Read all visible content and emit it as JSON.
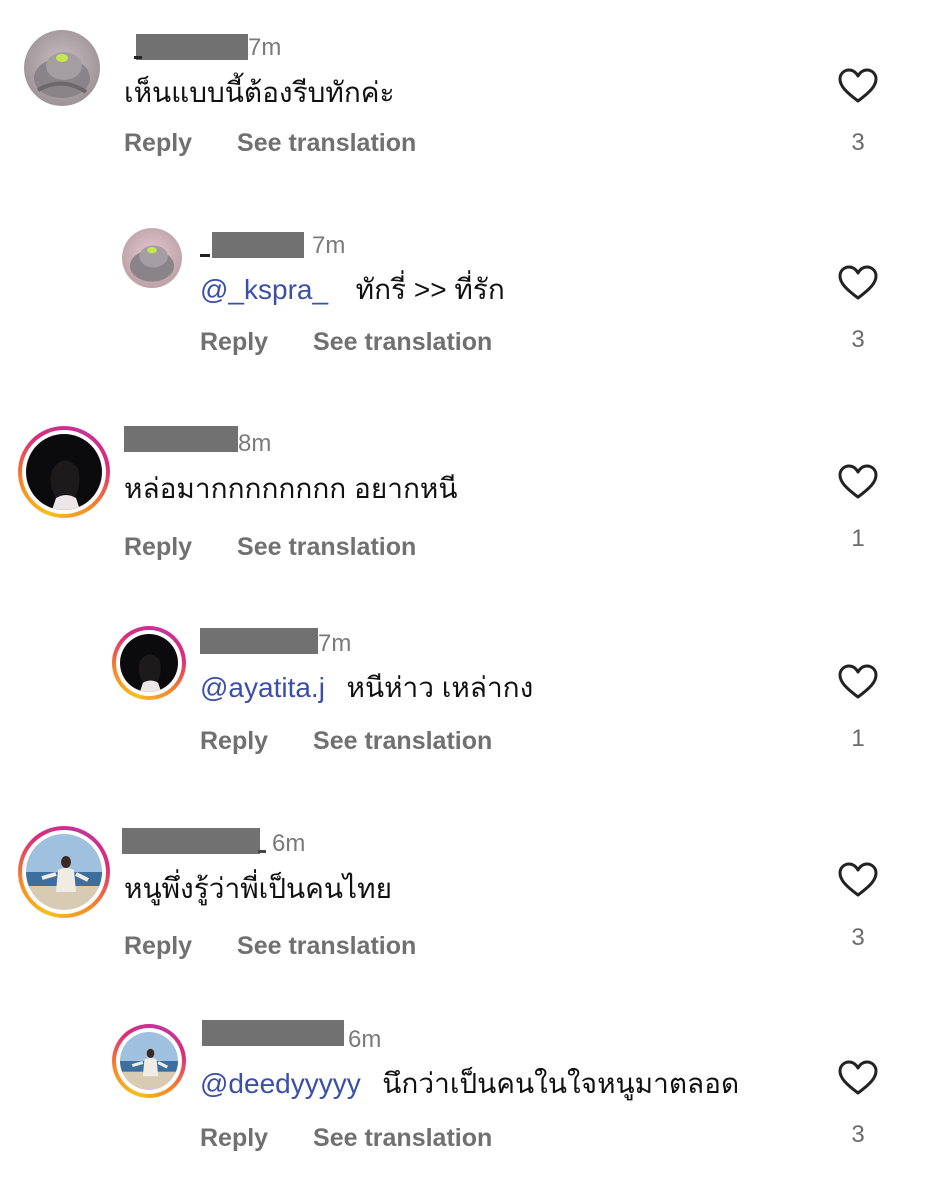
{
  "comments": [
    {
      "timestamp": "7m",
      "text": "เห็นแบบนี้ต้องรีบทักค่ะ",
      "mention": "",
      "reply_label": "Reply",
      "translate_label": "See translation",
      "likes": "3",
      "is_reply": false,
      "avatar": "cat-avatar"
    },
    {
      "timestamp": "7m",
      "text": "ทักรี่ >> ที่รัก",
      "mention": "@_kspra_",
      "reply_label": "Reply",
      "translate_label": "See translation",
      "likes": "3",
      "is_reply": true,
      "avatar": "cat-avatar"
    },
    {
      "timestamp": "8m",
      "text": "หล่อมากกกกกกกก อยากหนี",
      "mention": "",
      "reply_label": "Reply",
      "translate_label": "See translation",
      "likes": "1",
      "is_reply": false,
      "avatar": "night-portrait-avatar-story-ring"
    },
    {
      "timestamp": "7m",
      "text": "หนีห่าว เหล่ากง",
      "mention": "@ayatita.j",
      "reply_label": "Reply",
      "translate_label": "See translation",
      "likes": "1",
      "is_reply": true,
      "avatar": "night-portrait-avatar-story-ring"
    },
    {
      "timestamp": "6m",
      "text": "หนูพึ่งรู้ว่าพี่เป็นคนไทย",
      "mention": "",
      "reply_label": "Reply",
      "translate_label": "See translation",
      "likes": "3",
      "is_reply": false,
      "avatar": "beach-avatar-story-ring"
    },
    {
      "timestamp": "6m",
      "text": "นึกว่าเป็นคนในใจหนูมาตลอด",
      "mention": "@deedyyyyy",
      "reply_label": "Reply",
      "translate_label": "See translation",
      "likes": "3",
      "is_reply": true,
      "avatar": "beach-avatar-story-ring"
    }
  ],
  "colors": {
    "mention": "#3b4fa8",
    "action_text": "#707070",
    "redaction": "#717171"
  },
  "icons": {
    "like": "heart-outline-icon"
  }
}
